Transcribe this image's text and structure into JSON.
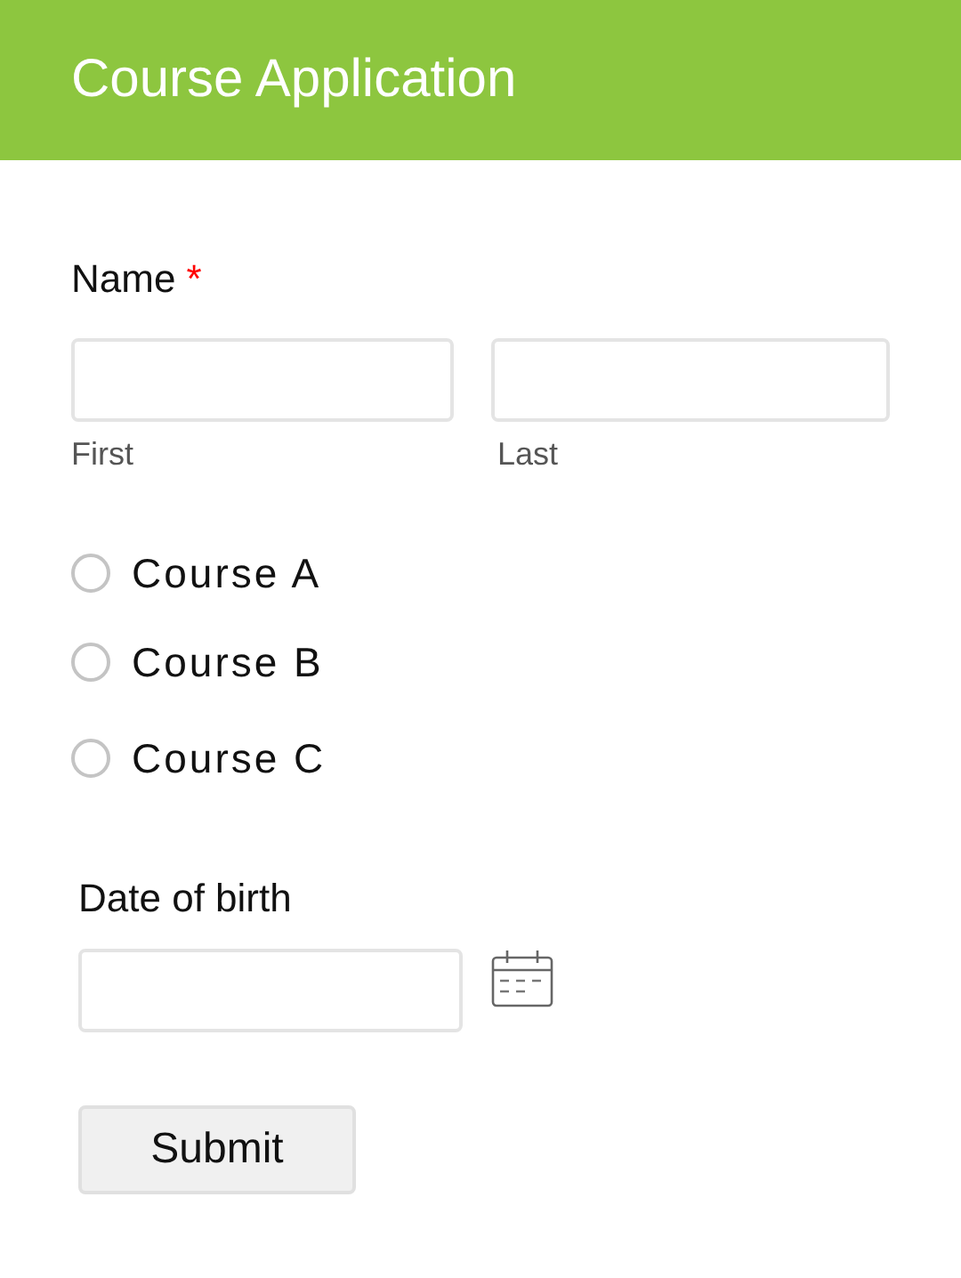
{
  "header": {
    "title": "Course Application"
  },
  "name_field": {
    "label": "Name",
    "required_mark": "*",
    "parts": [
      {
        "sublabel": "First"
      },
      {
        "sublabel": "Last"
      }
    ]
  },
  "courses": [
    {
      "label": "Course A",
      "selected": false
    },
    {
      "label": "Course B",
      "selected": false
    },
    {
      "label": "Course C",
      "selected": false
    }
  ],
  "date_field": {
    "label": "Date of birth"
  },
  "submit": {
    "label": "Submit"
  }
}
